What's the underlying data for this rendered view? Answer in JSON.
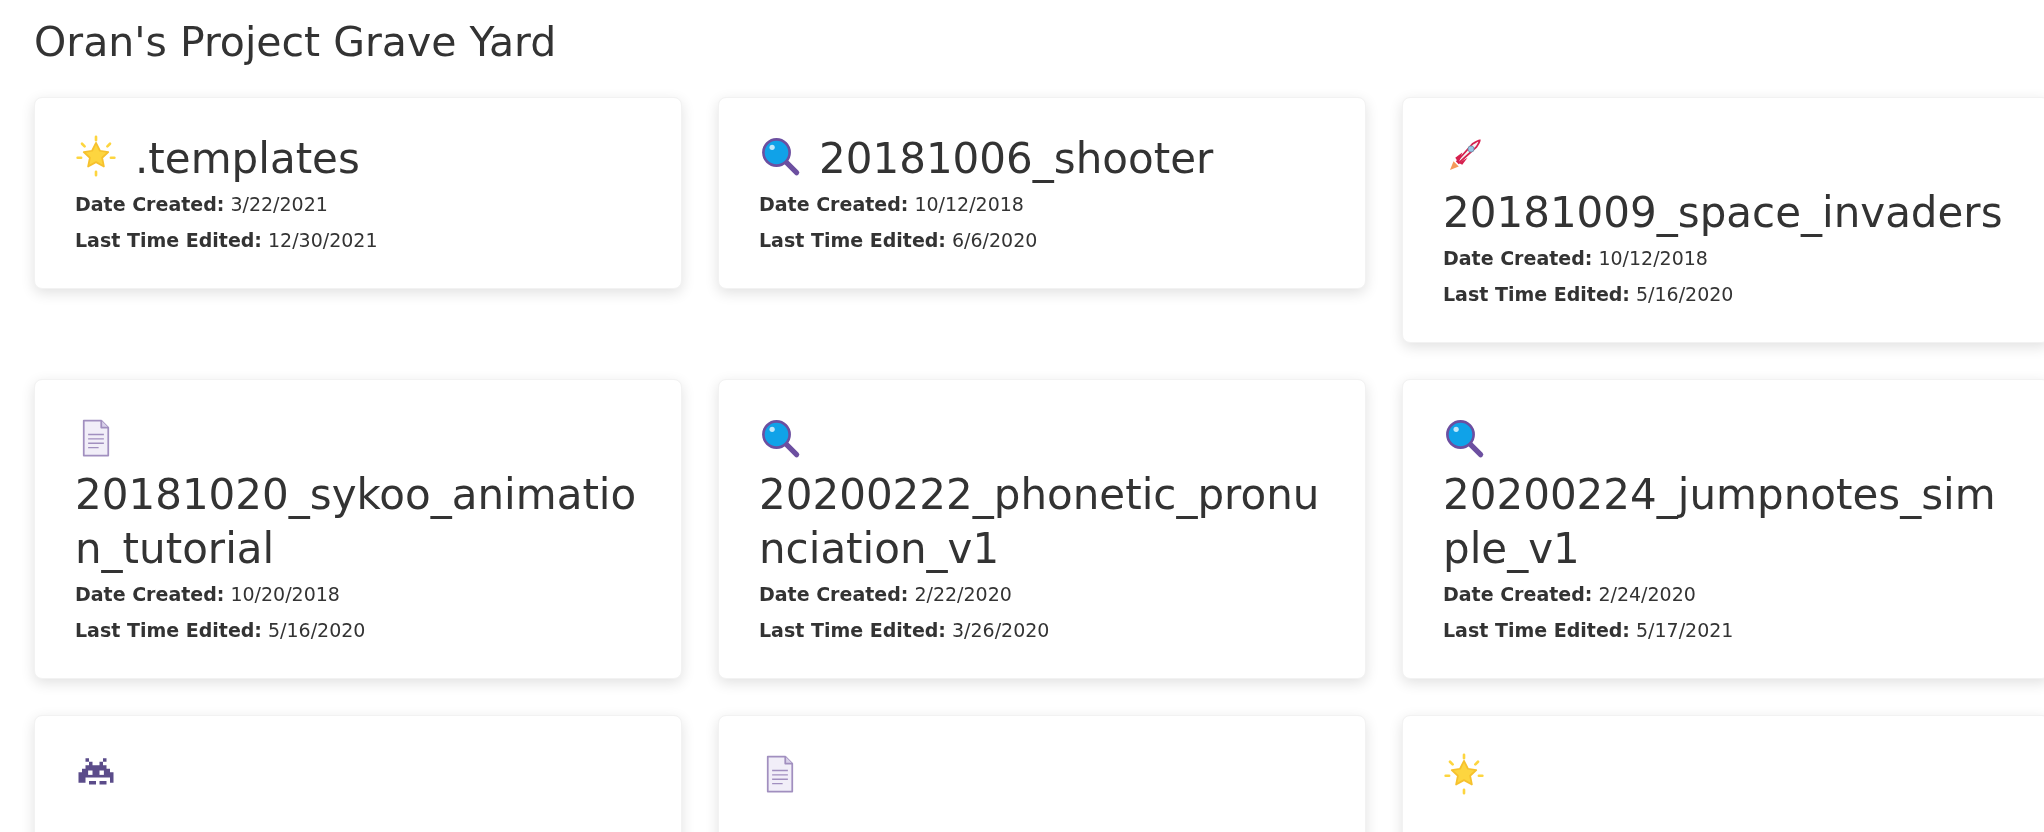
{
  "title": "Oran's Project Grave Yard",
  "projects": [
    {
      "kind": "sparkle",
      "name": ".templates",
      "created_label": "Date Created:",
      "created": "3/22/2021",
      "edited_label": "Last Time Edited:",
      "edited": "12/30/2021"
    },
    {
      "kind": "magnifier",
      "name": "20181006_shooter",
      "created_label": "Date Created:",
      "created": "10/12/2018",
      "edited_label": "Last Time Edited:",
      "edited": "6/6/2020"
    },
    {
      "kind": "rocket",
      "name": "20181009_space_invaders",
      "created_label": "Date Created:",
      "created": "10/12/2018",
      "edited_label": "Last Time Edited:",
      "edited": "5/16/2020"
    },
    {
      "kind": "document",
      "name": "20181020_sykoo_animation_tutorial",
      "created_label": "Date Created:",
      "created": "10/20/2018",
      "edited_label": "Last Time Edited:",
      "edited": "5/16/2020"
    },
    {
      "kind": "magnifier",
      "name": "20200222_phonetic_pronunciation_v1",
      "created_label": "Date Created:",
      "created": "2/22/2020",
      "edited_label": "Last Time Edited:",
      "edited": "3/26/2020"
    },
    {
      "kind": "magnifier",
      "name": "20200224_jumpnotes_simple_v1",
      "created_label": "Date Created:",
      "created": "2/24/2020",
      "edited_label": "Last Time Edited:",
      "edited": "5/17/2021"
    },
    {
      "kind": "alien"
    },
    {
      "kind": "document"
    },
    {
      "kind": "sparkle"
    }
  ]
}
